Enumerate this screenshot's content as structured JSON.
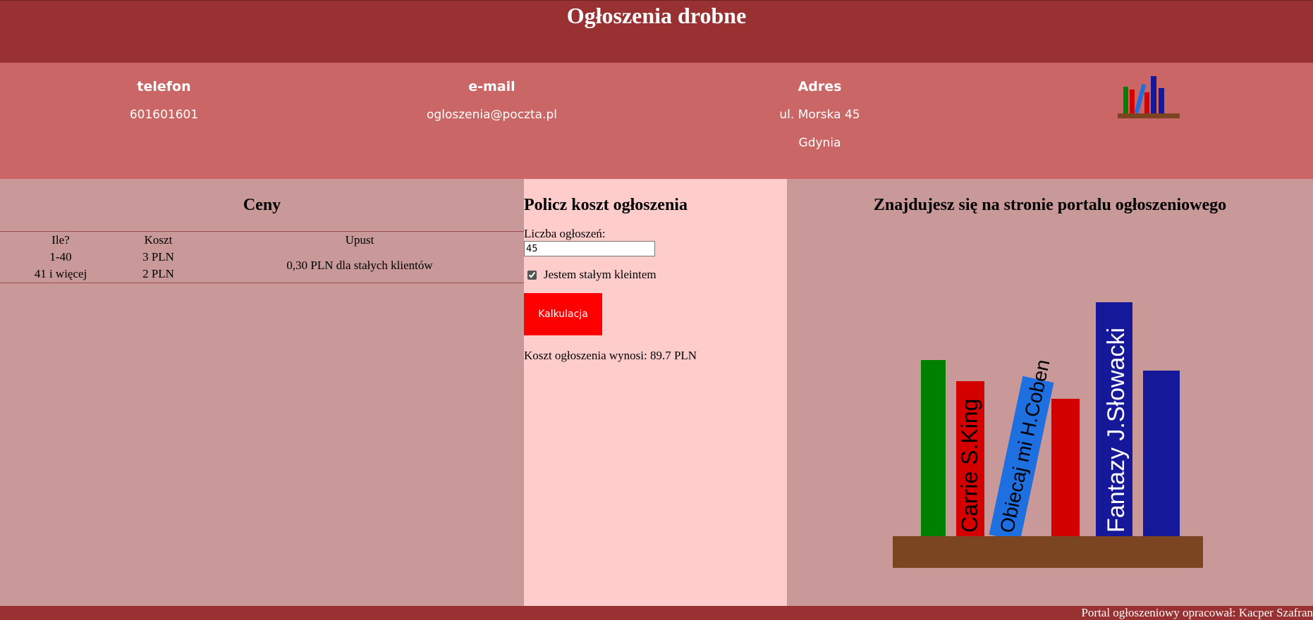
{
  "header": {
    "title": "Ogłoszenia drobne"
  },
  "contact": {
    "phone_heading": "telefon",
    "phone": "601601601",
    "email_heading": "e-mail",
    "email": "ogloszenia@poczta.pl",
    "address_heading": "Adres",
    "address_street": "ul. Morska 45",
    "address_city": "Gdynia"
  },
  "prices": {
    "title": "Ceny",
    "columns": [
      "Ile?",
      "Koszt",
      "Upust"
    ],
    "rows": [
      {
        "count": "1-40",
        "cost": "3 PLN"
      },
      {
        "count": "41 i więcej",
        "cost": "2 PLN"
      }
    ],
    "discount": "0,30 PLN dla stałych klientów"
  },
  "calculator": {
    "title": "Policz koszt ogłoszenia",
    "count_label": "Liczba ogłoszeń:",
    "count_value": "45",
    "regular_label": "Jestem stałym kleintem",
    "regular_checked": true,
    "button_label": "Kalkulacja",
    "result": "Koszt ogłoszenia wynosi: 89.7 PLN"
  },
  "info": {
    "title": "Znajdujesz się na stronie portalu ogłoszeniowego",
    "books": {
      "book_2": "Carrie S.King",
      "book_3": "Obiecaj mi H.Coben",
      "book_5": "Fantazy J.Słowacki"
    }
  },
  "colors": {
    "header": "#993133",
    "contact_bar": "#cb6666",
    "panel": "#c99898",
    "calc_panel": "#ffcccc",
    "button": "#ff0000",
    "shelf": "#7b4522"
  },
  "footer": {
    "credit": "Portal ogłoszeniowy opracował: Kacper Szafran"
  }
}
